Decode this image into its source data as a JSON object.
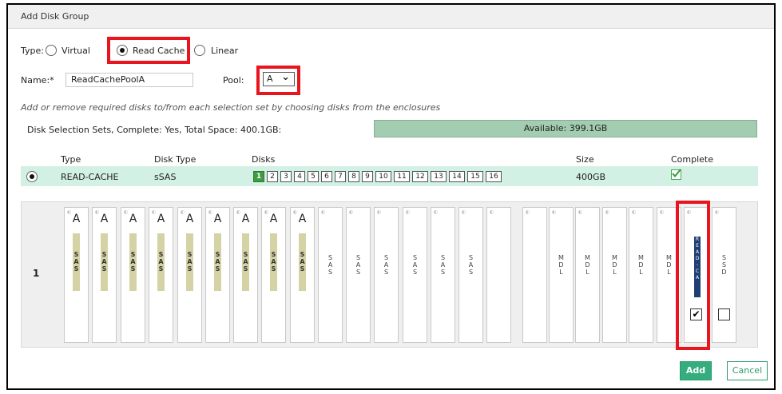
{
  "dialog": {
    "title": "Add Disk Group"
  },
  "type": {
    "label": "Type:",
    "options": [
      {
        "label": "Virtual",
        "selected": false
      },
      {
        "label": "Read Cache",
        "selected": true
      },
      {
        "label": "Linear",
        "selected": false
      }
    ]
  },
  "name": {
    "label": "Name:*",
    "value": "ReadCachePoolA"
  },
  "pool": {
    "label": "Pool:",
    "value": "A",
    "arrow": "⌄"
  },
  "instruction": "Add or remove required disks to/from each selection set by choosing disks from the enclosures",
  "selection_summary": "Disk Selection Sets, Complete: Yes, Total Space: 400.1GB:",
  "available": {
    "label": "Available: 399.1GB"
  },
  "table": {
    "headers": {
      "type": "Type",
      "disk_type": "Disk Type",
      "disks": "Disks",
      "size": "Size",
      "complete": "Complete"
    },
    "row": {
      "type": "READ-CACHE",
      "disk_type": "sSAS",
      "size": "400GB",
      "complete_icon": "check-icon",
      "disk_numbers": [
        "1",
        "2",
        "3",
        "4",
        "5",
        "6",
        "7",
        "8",
        "9",
        "10",
        "11",
        "12",
        "13",
        "14",
        "15",
        "16"
      ],
      "selected_disk": "1"
    }
  },
  "enclosure": {
    "id": "1",
    "slots": [
      {
        "pool": "A",
        "label": "SAS",
        "band": true
      },
      {
        "pool": "A",
        "label": "SAS",
        "band": true
      },
      {
        "pool": "A",
        "label": "SAS",
        "band": true
      },
      {
        "pool": "A",
        "label": "SAS",
        "band": true
      },
      {
        "pool": "A",
        "label": "SAS",
        "band": true
      },
      {
        "pool": "A",
        "label": "SAS",
        "band": true
      },
      {
        "pool": "A",
        "label": "SAS",
        "band": true
      },
      {
        "pool": "A",
        "label": "SAS",
        "band": true
      },
      {
        "pool": "A",
        "label": "SAS",
        "band": true
      },
      {
        "pool": "",
        "label": "SAS",
        "band": false
      },
      {
        "pool": "",
        "label": "SAS",
        "band": false
      },
      {
        "pool": "",
        "label": "SAS",
        "band": false
      },
      {
        "pool": "",
        "label": "SAS",
        "band": false
      },
      {
        "pool": "",
        "label": "SAS",
        "band": false
      },
      {
        "pool": "",
        "label": "SAS",
        "band": false
      },
      {
        "pool": "",
        "label": "",
        "band": false
      },
      {
        "pool": "",
        "label": "",
        "band": false
      },
      {
        "pool": "",
        "label": "MDL",
        "band": false
      },
      {
        "pool": "",
        "label": "MDL",
        "band": false
      },
      {
        "pool": "",
        "label": "MDL",
        "band": false
      },
      {
        "pool": "",
        "label": "MDL",
        "band": false
      },
      {
        "pool": "",
        "label": "MDL",
        "band": false
      },
      {
        "pool": "",
        "label": "READ-CA",
        "band": false,
        "read_cache": true,
        "checked": true
      },
      {
        "pool": "",
        "label": "SSD",
        "band": false,
        "checked": false
      }
    ]
  },
  "buttons": {
    "add": "Add",
    "cancel": "Cancel"
  },
  "colors": {
    "accent": "#36ad7e",
    "highlight_red": "#e8141e",
    "selected_row": "#d2f0e4",
    "available_bar": "#a3cdb1",
    "selected_disk": "#3f9c43",
    "pool_band": "#d5d3a6",
    "read_cache_band": "#1e3f73"
  }
}
